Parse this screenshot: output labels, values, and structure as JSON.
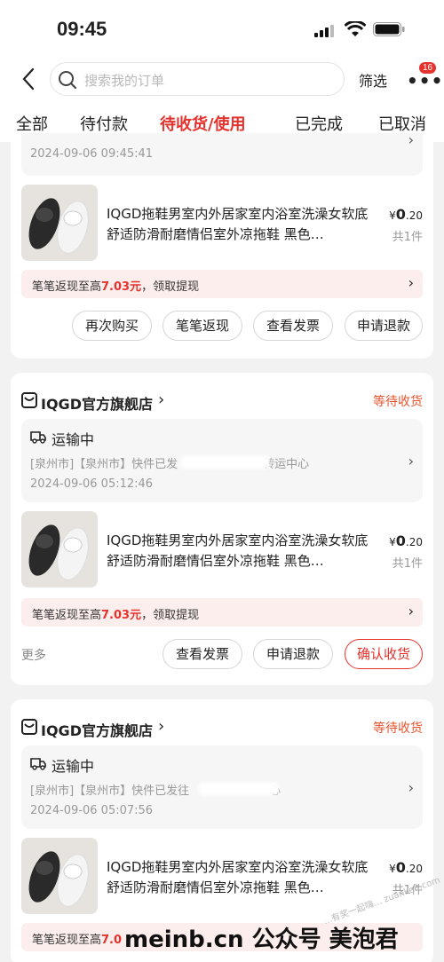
{
  "status_bar": {
    "time": "09:45"
  },
  "header": {
    "search_placeholder": "搜索我的订单",
    "filter_label": "筛选",
    "more_badge": "16"
  },
  "tabs": [
    {
      "label": "全部"
    },
    {
      "label": "待付款"
    },
    {
      "label": "待收货/使用"
    },
    {
      "label": "已完成"
    },
    {
      "label": "已取消"
    }
  ],
  "orders": [
    {
      "logistics_time": "2024-09-06 09:45:41",
      "product_title": "IQGD拖鞋男室内外居家室内浴室洗澡女软底舒适防滑耐磨情侣室外凉拖鞋 黑色…",
      "price_symbol": "¥",
      "price_int": "0",
      "price_dec": ".20",
      "qty": "共1件",
      "cashback_prefix": "笔笔返现至高",
      "cashback_amount": "7.03元",
      "cashback_suffix": "，领取提现",
      "buttons": [
        "再次购买",
        "笔笔返现",
        "查看发票",
        "申请退款"
      ]
    },
    {
      "store": "IQGD官方旗舰店",
      "status": "等待收货",
      "logistics_title": "运输中",
      "logistics_detail_a": "[泉州市]【泉州市】快件已发",
      "logistics_detail_b": "转运中心",
      "logistics_time": "2024-09-06 05:12:46",
      "product_title": "IQGD拖鞋男室内外居家室内浴室洗澡女软底舒适防滑耐磨情侣室外凉拖鞋 黑色…",
      "price_symbol": "¥",
      "price_int": "0",
      "price_dec": ".20",
      "qty": "共1件",
      "cashback_prefix": "笔笔返现至高",
      "cashback_amount": "7.03元",
      "cashback_suffix": "，领取提现",
      "more_label": "更多",
      "buttons": [
        "查看发票",
        "申请退款",
        "确认收货"
      ]
    },
    {
      "store": "IQGD官方旗舰店",
      "status": "等待收货",
      "logistics_title": "运输中",
      "logistics_detail_a": "[泉州市]【泉州市】快件已发往",
      "logistics_detail_b": "心",
      "logistics_time": "2024-09-06 05:07:56",
      "product_title": "IQGD拖鞋男室内外居家室内浴室洗澡女软底舒适防滑耐磨情侣室外凉拖鞋 黑色…",
      "price_symbol": "¥",
      "price_int": "0",
      "price_dec": ".20",
      "qty": "共1件",
      "cashback_prefix": "笔笔返现至高",
      "cashback_amount": "7.0"
    }
  ],
  "watermark": "meinb.cn 公众号 美泡君",
  "watermark_small": "...有奖一起嗨... zuanke8.com"
}
